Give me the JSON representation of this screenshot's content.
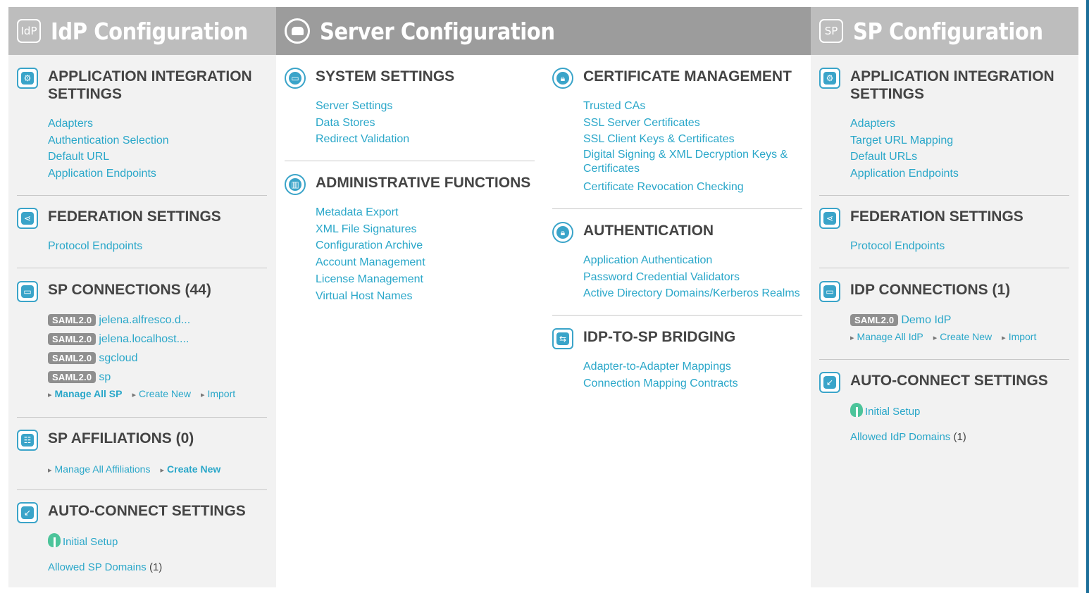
{
  "columns": {
    "idp": {
      "title": "IdP Configuration",
      "icon": "idp-icon",
      "icon_text": "IdP"
    },
    "server": {
      "title": "Server Configuration",
      "icon": "server-icon"
    },
    "sp": {
      "title": "SP Configuration",
      "icon": "sp-icon",
      "icon_text": "SP"
    }
  },
  "idp": {
    "app_integration": {
      "title": "APPLICATION INTEGRATION SETTINGS",
      "links": [
        "Adapters",
        "Authentication Selection",
        "Default URL",
        "Application Endpoints"
      ]
    },
    "federation": {
      "title": "FEDERATION SETTINGS",
      "links": [
        "Protocol Endpoints"
      ]
    },
    "sp_connections": {
      "title": "SP CONNECTIONS (44)",
      "badge": "SAML2.0",
      "items": [
        "jelena.alfresco.d...",
        "jelena.localhost....",
        "sgcloud",
        "sp"
      ],
      "actions": [
        "Manage All SP",
        "Create New",
        "Import"
      ]
    },
    "sp_affiliations": {
      "title": "SP AFFILIATIONS (0)",
      "actions": [
        "Manage All Affiliations",
        "Create New"
      ]
    },
    "auto_connect": {
      "title": "AUTO-CONNECT SETTINGS",
      "initial_setup": "Initial Setup",
      "allowed_domains": "Allowed SP Domains",
      "allowed_count": "(1)"
    }
  },
  "server": {
    "system": {
      "title": "SYSTEM SETTINGS",
      "links": [
        "Server Settings",
        "Data Stores",
        "Redirect Validation"
      ]
    },
    "admin": {
      "title": "ADMINISTRATIVE FUNCTIONS",
      "links": [
        "Metadata Export",
        "XML File Signatures",
        "Configuration Archive",
        "Account Management",
        "License Management",
        "Virtual Host Names"
      ]
    },
    "certificates": {
      "title": "CERTIFICATE MANAGEMENT",
      "links": [
        "Trusted CAs",
        "SSL Server Certificates",
        "SSL Client Keys & Certificates",
        "Digital Signing & XML Decryption Keys & Certificates",
        "Certificate Revocation Checking"
      ]
    },
    "authentication": {
      "title": "AUTHENTICATION",
      "links": [
        "Application Authentication",
        "Password Credential Validators",
        "Active Directory Domains/Kerberos Realms"
      ]
    },
    "bridging": {
      "title": "IDP-TO-SP BRIDGING",
      "links": [
        "Adapter-to-Adapter Mappings",
        "Connection Mapping Contracts"
      ]
    }
  },
  "sp": {
    "app_integration": {
      "title": "APPLICATION INTEGRATION SETTINGS",
      "links": [
        "Adapters",
        "Target URL Mapping",
        "Default URLs",
        "Application Endpoints"
      ]
    },
    "federation": {
      "title": "FEDERATION SETTINGS",
      "links": [
        "Protocol Endpoints"
      ]
    },
    "idp_connections": {
      "title": "IDP CONNECTIONS (1)",
      "badge": "SAML2.0",
      "items": [
        "Demo IdP"
      ],
      "actions": [
        "Manage All IdP",
        "Create New",
        "Import"
      ]
    },
    "auto_connect": {
      "title": "AUTO-CONNECT SETTINGS",
      "initial_setup": "Initial Setup",
      "allowed_domains": "Allowed IdP Domains",
      "allowed_count": "(1)"
    }
  },
  "colors": {
    "link": "#2aa7c9",
    "icon": "#3aa4c9",
    "heading": "#444444",
    "badge": "#8f8f8f",
    "header_bg": "#bdbdbd",
    "server_header_bg": "#9c9c9c"
  }
}
